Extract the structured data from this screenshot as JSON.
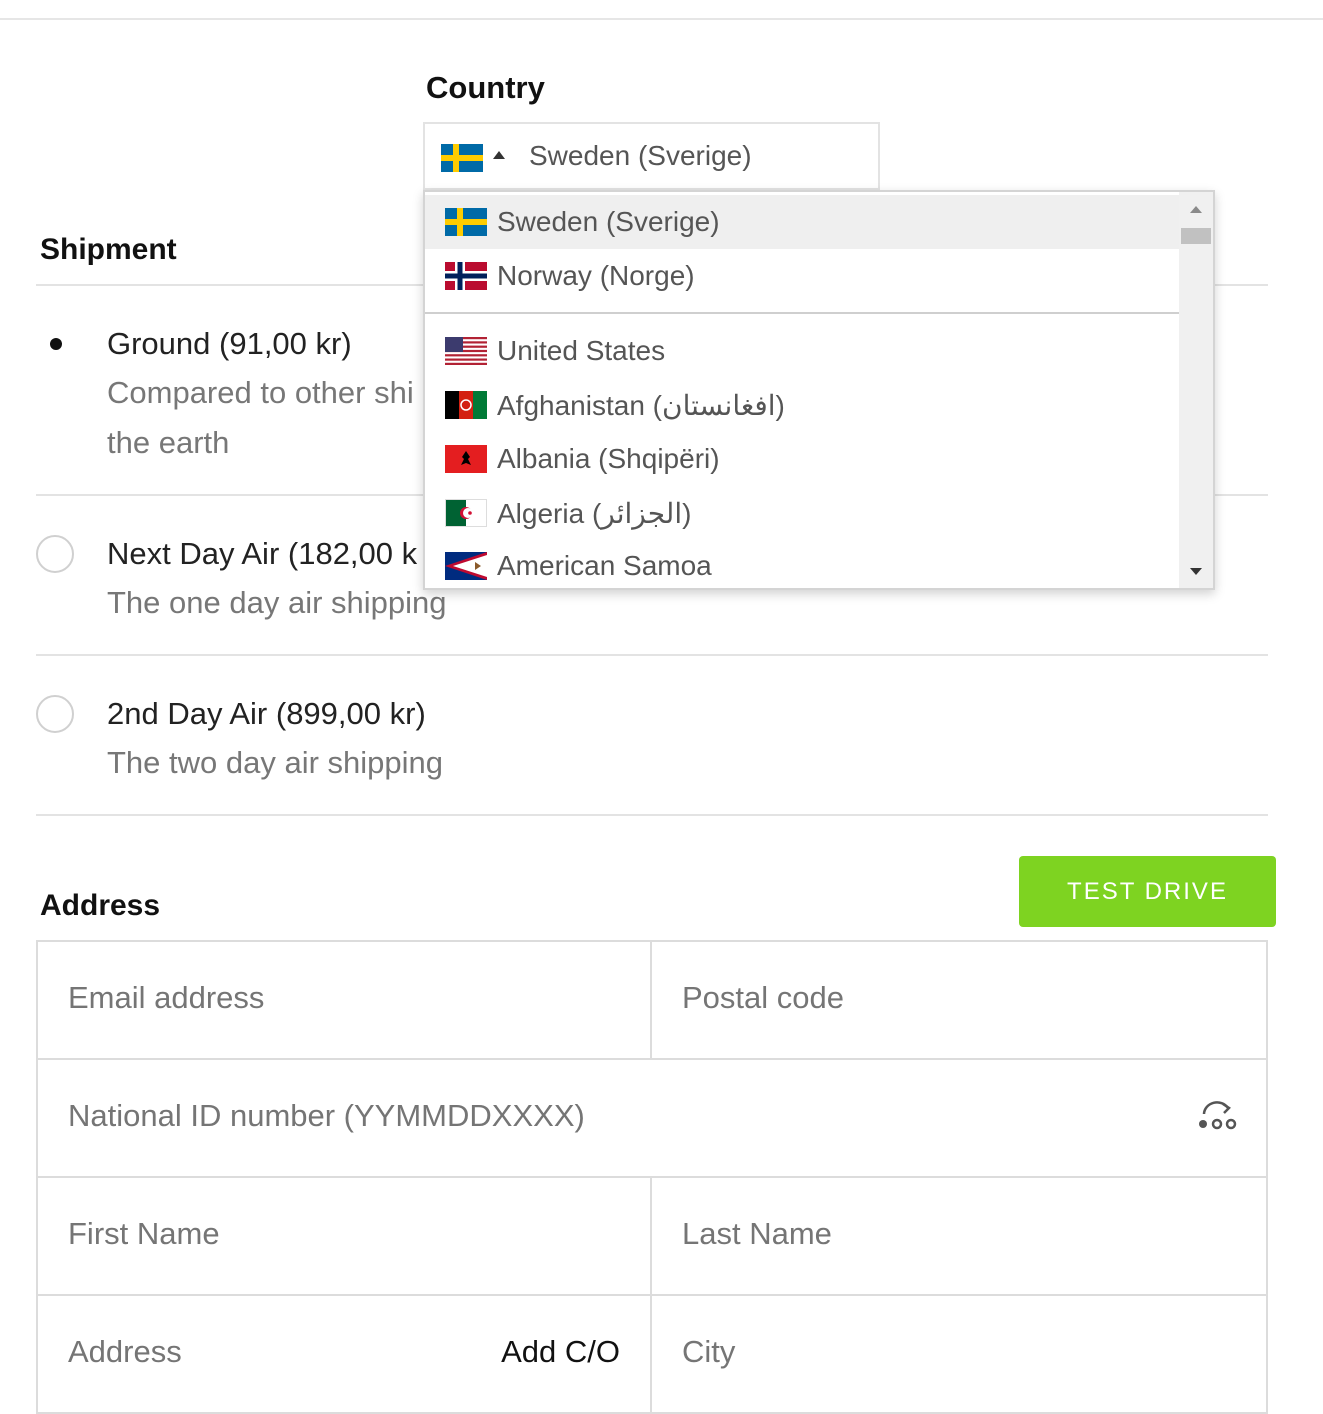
{
  "country": {
    "label": "Country",
    "selected": "Sweden (Sverige)",
    "options": [
      {
        "name": "Sweden (Sverige)",
        "flag": "sweden-flag"
      },
      {
        "name": "Norway (Norge)",
        "flag": "norway-flag"
      },
      {
        "name": "United States",
        "flag": "us-flag"
      },
      {
        "name": "Afghanistan (افغانستان)",
        "flag": "afghanistan-flag"
      },
      {
        "name": "Albania (Shqipëri)",
        "flag": "albania-flag"
      },
      {
        "name": "Algeria (الجزائر)",
        "flag": "algeria-flag"
      },
      {
        "name": "American Samoa",
        "flag": "american-samoa-flag"
      }
    ]
  },
  "shipment": {
    "title": "Shipment",
    "options": [
      {
        "title": "Ground (91,00 kr)",
        "desc_line1": "Compared to other shi",
        "desc_line2": "the earth",
        "selected": true
      },
      {
        "title": "Next Day Air (182,00 k",
        "desc_line1": "The one day air shipping",
        "selected": false
      },
      {
        "title": "2nd Day Air (899,00 kr)",
        "desc_line1": "The two day air shipping",
        "selected": false
      }
    ]
  },
  "test_drive": {
    "label": "TEST DRIVE",
    "color": "#7ed321"
  },
  "address": {
    "title": "Address",
    "email_placeholder": "Email address",
    "postal_placeholder": "Postal code",
    "national_id_placeholder": "National ID number (YYMMDDXXXX)",
    "first_name_placeholder": "First Name",
    "last_name_placeholder": "Last Name",
    "address_placeholder": "Address",
    "add_co_label": "Add C/O",
    "city_placeholder": "City",
    "lookup_icon": "address-lookup-icon"
  }
}
